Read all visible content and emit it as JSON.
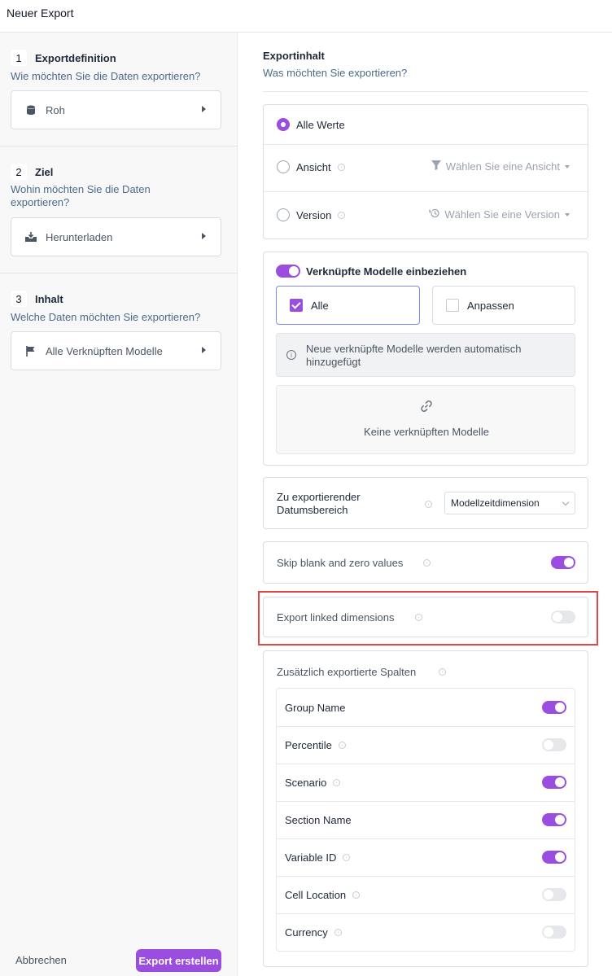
{
  "header": {
    "title": "Neuer Export"
  },
  "steps": [
    {
      "num": "1",
      "title": "Exportdefinition",
      "question": "Wie möchten Sie die Daten exportieren?",
      "value": "Roh",
      "icon": "database-icon"
    },
    {
      "num": "2",
      "title": "Ziel",
      "question": "Wohin möchten Sie die Daten exportieren?",
      "value": "Herunterladen",
      "icon": "download-tray-icon"
    },
    {
      "num": "3",
      "title": "Inhalt",
      "question": "Welche Daten möchten Sie exportieren?",
      "value": "Alle Verknüpften Modelle",
      "icon": "flag-icon"
    }
  ],
  "footer": {
    "cancel": "Abbrechen",
    "submit": "Export erstellen"
  },
  "content": {
    "title": "Exportinhalt",
    "subtitle": "Was möchten Sie exportieren?",
    "radios": [
      {
        "label": "Alle Werte",
        "selected": true
      },
      {
        "label": "Ansicht",
        "selected": false,
        "picker": "Wählen Sie eine Ansicht",
        "picker_icon": "filter-icon"
      },
      {
        "label": "Version",
        "selected": false,
        "picker": "Wählen Sie eine Version",
        "picker_icon": "history-icon"
      }
    ],
    "linked": {
      "toggle_label": "Verknüpfte Modelle einbeziehen",
      "toggle_on": true,
      "choice_all": "Alle",
      "choice_custom": "Anpassen",
      "info": "Neue verknüpfte Modelle werden automatisch hinzugefügt",
      "empty": "Keine verknüpften Modelle"
    },
    "date_range": {
      "label": "Zu exportierender Datumsbereich",
      "value": "Modellzeitdimension"
    },
    "skip_blank": {
      "label": "Skip blank and zero values",
      "on": true
    },
    "export_linked_dims": {
      "label": "Export linked dimensions",
      "on": false
    },
    "extra_columns": {
      "title": "Zusätzlich exportierte Spalten",
      "items": [
        {
          "label": "Group Name",
          "on": true,
          "help": false
        },
        {
          "label": "Percentile",
          "on": false,
          "help": true
        },
        {
          "label": "Scenario",
          "on": true,
          "help": true
        },
        {
          "label": "Section Name",
          "on": true,
          "help": false
        },
        {
          "label": "Variable ID",
          "on": true,
          "help": true
        },
        {
          "label": "Cell Location",
          "on": false,
          "help": true
        },
        {
          "label": "Currency",
          "on": false,
          "help": true
        }
      ]
    }
  },
  "colors": {
    "accent": "#9b4de0",
    "highlight": "#e0484c"
  }
}
